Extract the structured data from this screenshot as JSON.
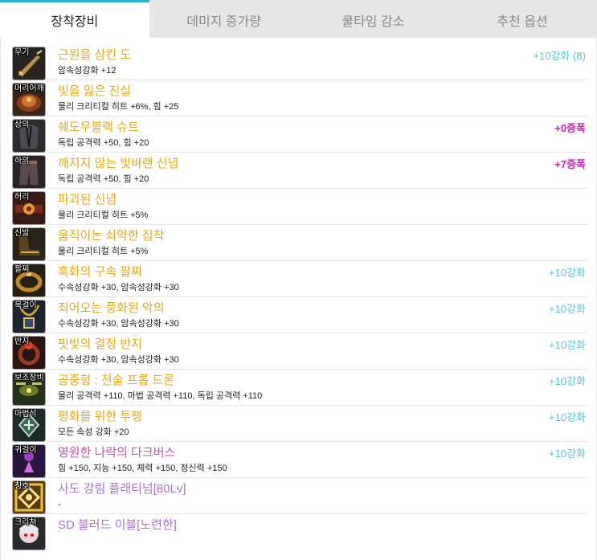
{
  "tabs": [
    "장착장비",
    "데미지 증가량",
    "쿨타임 감소",
    "추천 옵션"
  ],
  "colors": {
    "tab_active_accent": "#2bb4c6",
    "rarity_unique": "#e8a91e",
    "rarity_legendary": "#c454a8",
    "rarity_rare": "#a872d6",
    "badge_reinforce": "#5cc3d8",
    "badge_amplify": "#cc1fad"
  },
  "items": [
    {
      "slot": "무기",
      "icon": "sword-icon",
      "name": "근원을 삼킨 도",
      "rarity": "unique",
      "stat": "암속성강화 +12",
      "badge": "+10강화 (8)",
      "badge_type": "reinforce"
    },
    {
      "slot": "머리어깨",
      "icon": "shoulder-armor-icon",
      "name": "빛을 잃은 진실",
      "rarity": "unique",
      "stat": "물리 크리티컬 히트 +6%, 힘 +25",
      "badge": "",
      "badge_type": ""
    },
    {
      "slot": "상의",
      "icon": "top-armor-icon",
      "name": "쉐도우블랙 슈트",
      "rarity": "unique",
      "stat": "독립 공격력 +50, 힘 +20",
      "badge": "+0증폭",
      "badge_type": "amplify"
    },
    {
      "slot": "하의",
      "icon": "pants-armor-icon",
      "name": "깨지지 않는 빛바랜 신념",
      "rarity": "unique",
      "stat": "독립 공격력 +50, 힘 +20",
      "badge": "+7증폭",
      "badge_type": "amplify"
    },
    {
      "slot": "허리",
      "icon": "belt-icon",
      "name": "파괴된 신념",
      "rarity": "unique",
      "stat": "물리 크리티컬 히트 +5%",
      "badge": "",
      "badge_type": ""
    },
    {
      "slot": "신발",
      "icon": "shoes-icon",
      "name": "움직이는 쇠약한 집착",
      "rarity": "unique",
      "stat": "물리 크리티컬 히트 +5%",
      "badge": "",
      "badge_type": ""
    },
    {
      "slot": "팔찌",
      "icon": "bracelet-icon",
      "name": "흑화의 구속 팔찌",
      "rarity": "unique",
      "stat": "수속성강화 +30, 암속성강화 +30",
      "badge": "+10강화",
      "badge_type": "reinforce"
    },
    {
      "slot": "목걸이",
      "icon": "necklace-icon",
      "name": "죄어오는 풍화된 악의",
      "rarity": "unique",
      "stat": "수속성강화 +30, 암속성강화 +30",
      "badge": "+10강화",
      "badge_type": "reinforce"
    },
    {
      "slot": "반지",
      "icon": "ring-icon",
      "name": "핏빛의 결정 반지",
      "rarity": "unique",
      "stat": "수속성강화 +30, 암속성강화 +30",
      "badge": "+10강화",
      "badge_type": "reinforce"
    },
    {
      "slot": "보조장비",
      "icon": "drone-icon",
      "name": "공중형 : 전술 프롭 드론",
      "rarity": "unique",
      "stat": "물리 공격력 +110, 마법 공격력 +110, 독립 공격력 +110",
      "badge": "+10강화",
      "badge_type": "reinforce"
    },
    {
      "slot": "마법석",
      "icon": "magic-stone-icon",
      "name": "평화를 위한 투쟁",
      "rarity": "unique",
      "stat": "모든 속성 강화 +20",
      "badge": "+10강화",
      "badge_type": "reinforce"
    },
    {
      "slot": "귀걸이",
      "icon": "earring-icon",
      "name": "영원한 나락의 다크버스",
      "rarity": "legendary",
      "stat": "힘 +150, 지능 +150, 체력 +150, 정신력 +150",
      "badge": "+10강화",
      "badge_type": "reinforce"
    },
    {
      "slot": "칭호",
      "icon": "title-emblem-icon",
      "name": "사도 강림 플래티넘[80Lv]",
      "rarity": "rare",
      "stat": "-",
      "badge": "",
      "badge_type": ""
    },
    {
      "slot": "크리쳐",
      "icon": "creature-icon",
      "name": "SD 블러드 이블[노련한]",
      "rarity": "rare",
      "stat": "",
      "badge": "",
      "badge_type": ""
    }
  ]
}
